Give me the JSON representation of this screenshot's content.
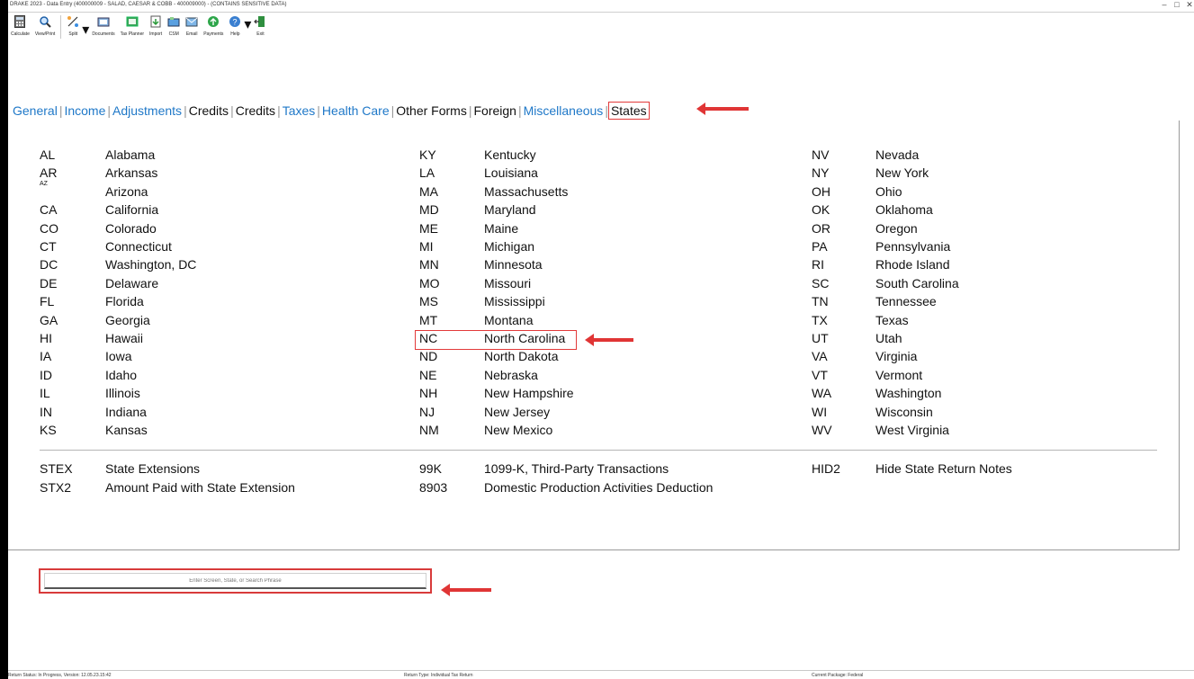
{
  "window": {
    "title": "DRAKE 2023 - Data Entry (400000009 - SALAD, CAESAR & COBB - 400009000) - (CONTAINS SENSITIVE DATA)",
    "minimize": "–",
    "maximize": "□",
    "close": "✕"
  },
  "toolbar": {
    "calculate": "Calculate",
    "view_print": "View/Print",
    "split": "Split",
    "documents": "Documents",
    "tax_planner": "Tax Planner",
    "import": "Import",
    "csm": "CSM",
    "email": "Email",
    "payments": "Payments",
    "help": "Help",
    "exit": "Exit"
  },
  "tabs": [
    {
      "label": "General"
    },
    {
      "label": "Income"
    },
    {
      "label": "Adjustments"
    },
    {
      "label": "Credits"
    },
    {
      "label": "Credits"
    },
    {
      "label": "Taxes"
    },
    {
      "label": "Health Care"
    },
    {
      "label": "Other Forms"
    },
    {
      "label": "Foreign"
    },
    {
      "label": "Miscellaneous"
    },
    {
      "label": "States"
    }
  ],
  "states": {
    "col1": [
      {
        "code": "AL",
        "name": "Alabama"
      },
      {
        "code": "AR",
        "name": "Arkansas"
      },
      {
        "code": "AZ",
        "name": "Arizona"
      },
      {
        "code": "CA",
        "name": "California"
      },
      {
        "code": "CO",
        "name": "Colorado"
      },
      {
        "code": "CT",
        "name": "Connecticut"
      },
      {
        "code": "DC",
        "name": "Washington, DC"
      },
      {
        "code": "DE",
        "name": "Delaware"
      },
      {
        "code": "FL",
        "name": "Florida"
      },
      {
        "code": "GA",
        "name": "Georgia"
      },
      {
        "code": "HI",
        "name": "Hawaii"
      },
      {
        "code": "IA",
        "name": "Iowa"
      },
      {
        "code": "ID",
        "name": "Idaho"
      },
      {
        "code": "IL",
        "name": "Illinois"
      },
      {
        "code": "IN",
        "name": "Indiana"
      },
      {
        "code": "KS",
        "name": "Kansas"
      }
    ],
    "col2": [
      {
        "code": "KY",
        "name": "Kentucky"
      },
      {
        "code": "LA",
        "name": "Louisiana"
      },
      {
        "code": "MA",
        "name": "Massachusetts"
      },
      {
        "code": "MD",
        "name": "Maryland"
      },
      {
        "code": "ME",
        "name": "Maine"
      },
      {
        "code": "MI",
        "name": "Michigan"
      },
      {
        "code": "MN",
        "name": "Minnesota"
      },
      {
        "code": "MO",
        "name": "Missouri"
      },
      {
        "code": "MS",
        "name": "Mississippi"
      },
      {
        "code": "MT",
        "name": "Montana"
      },
      {
        "code": "NC",
        "name": "North Carolina"
      },
      {
        "code": "ND",
        "name": "North Dakota"
      },
      {
        "code": "NE",
        "name": "Nebraska"
      },
      {
        "code": "NH",
        "name": "New Hampshire"
      },
      {
        "code": "NJ",
        "name": "New Jersey"
      },
      {
        "code": "NM",
        "name": "New Mexico"
      }
    ],
    "col3": [
      {
        "code": "NV",
        "name": "Nevada"
      },
      {
        "code": "NY",
        "name": "New York"
      },
      {
        "code": "OH",
        "name": "Ohio"
      },
      {
        "code": "OK",
        "name": "Oklahoma"
      },
      {
        "code": "OR",
        "name": "Oregon"
      },
      {
        "code": "PA",
        "name": "Pennsylvania"
      },
      {
        "code": "RI",
        "name": "Rhode Island"
      },
      {
        "code": "SC",
        "name": "South Carolina"
      },
      {
        "code": "TN",
        "name": "Tennessee"
      },
      {
        "code": "TX",
        "name": "Texas"
      },
      {
        "code": "UT",
        "name": "Utah"
      },
      {
        "code": "VA",
        "name": "Virginia"
      },
      {
        "code": "VT",
        "name": "Vermont"
      },
      {
        "code": "WA",
        "name": "Washington"
      },
      {
        "code": "WI",
        "name": "Wisconsin"
      },
      {
        "code": "WV",
        "name": "West Virginia"
      }
    ]
  },
  "extras": {
    "col1": [
      {
        "code": "STEX",
        "name": "State Extensions"
      },
      {
        "code": "STX2",
        "name": "Amount Paid with State Extension"
      }
    ],
    "col2": [
      {
        "code": "99K",
        "name": "1099-K, Third-Party Transactions"
      },
      {
        "code": "8903",
        "name": "Domestic Production Activities Deduction"
      }
    ],
    "col3": [
      {
        "code": "HID2",
        "name": "Hide State Return Notes"
      }
    ]
  },
  "search": {
    "placeholder": "Enter Screen, State, or Search Phrase"
  },
  "status": {
    "return_status": "Return Status: In Progress, Version: 12.05.23.15:42",
    "return_type": "Return Type: Individual Tax Return",
    "current_package": "Current Package: Federal"
  },
  "colors": {
    "tab_blue": "#1f78c8",
    "highlight_red": "#e23a3a"
  }
}
